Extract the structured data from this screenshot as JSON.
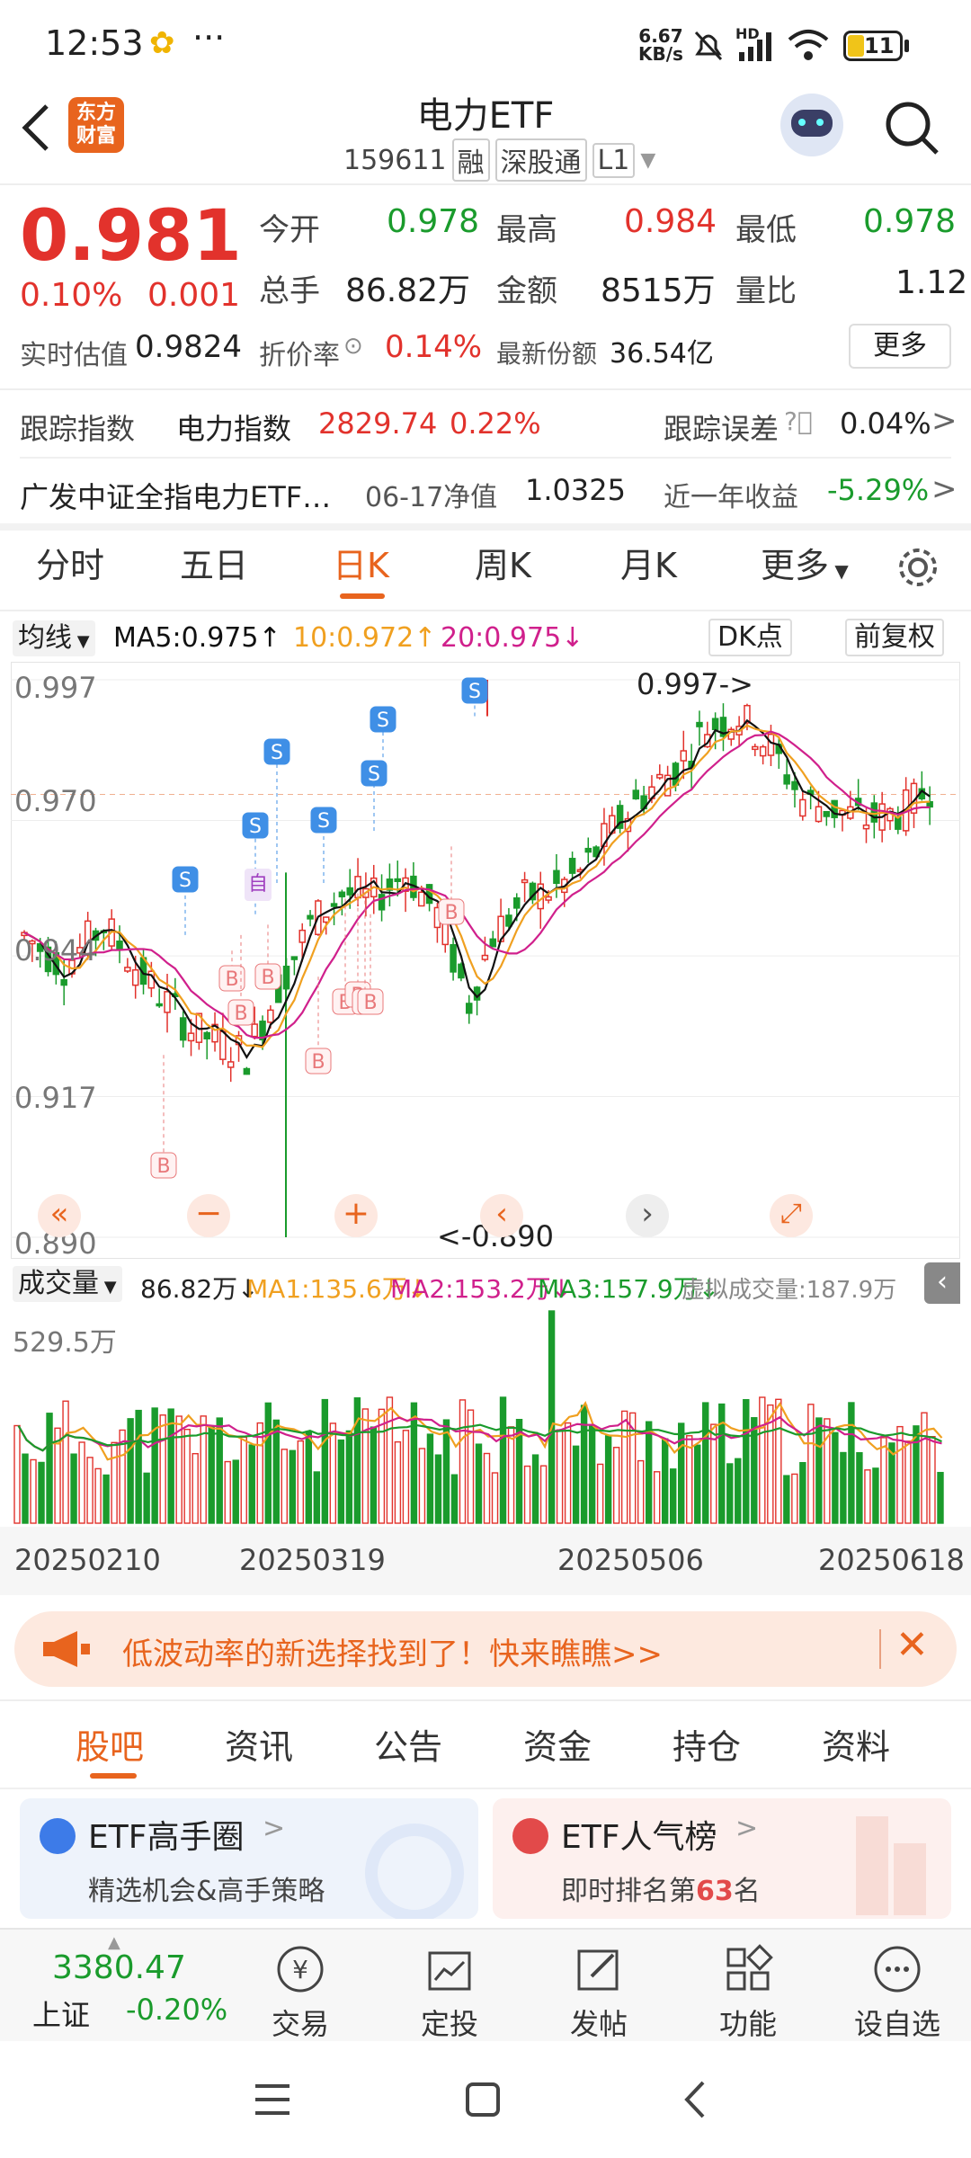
{
  "status_bar": {
    "time": "12:53",
    "dots": "···",
    "net_speed_value": "6.67",
    "net_speed_unit": "KB/s",
    "hd": "HD",
    "battery": "11"
  },
  "header": {
    "logo_line1": "东方",
    "logo_line2": "财富",
    "title": "电力ETF",
    "code": "159611",
    "tag_rong": "融",
    "tag_sgt": "深股通",
    "tag_l1": "L1"
  },
  "quote": {
    "price": "0.981",
    "change_pct": "0.10%",
    "change": "0.001",
    "open_label": "今开",
    "open": "0.978",
    "high_label": "最高",
    "high": "0.984",
    "low_label": "最低",
    "low": "0.978",
    "volume_label": "总手",
    "volume": "86.82万",
    "amount_label": "金额",
    "amount": "8515万",
    "ratio_label": "量比",
    "ratio": "1.12",
    "iopv_label": "实时估值",
    "iopv": "0.9824",
    "discount_label": "折价率",
    "discount": "0.14%",
    "shares_label": "最新份额",
    "shares": "36.54亿",
    "more_button": "更多"
  },
  "tracking": {
    "label": "跟踪指数",
    "index_name": "电力指数",
    "index_value": "2829.74",
    "index_change": "0.22%",
    "error_label": "跟踪误差",
    "error_value": "0.04%",
    "fund_name": "广发中证全指电力ETF…",
    "nav_date_label": "06-17净值",
    "nav_value": "1.0325",
    "year_return_label": "近一年收益",
    "year_return": "-5.29%"
  },
  "chart_tabs": [
    "分时",
    "五日",
    "日K",
    "周K",
    "月K",
    "更多"
  ],
  "active_chart_tab": "日K",
  "ma_bar": {
    "selector": "均线",
    "ma5": "MA5:0.975",
    "ma10": "10:0.972",
    "ma20": "20:0.975",
    "dk_button": "DK点",
    "fq_button": "前复权"
  },
  "price_axis": [
    "0.997",
    "0.970",
    "0.944",
    "0.917",
    "0.890"
  ],
  "chart_annotations": {
    "max_label": "0.997->",
    "min_label": "<-0.890",
    "self_tag": "自"
  },
  "volume_bar": {
    "selector": "成交量",
    "vol": "86.82万",
    "ma1": "MA1:135.6万",
    "ma2": "MA2:153.2万",
    "ma3": "MA3:157.9万",
    "virtual": "虚拟成交量:187.9万",
    "axis_max": "529.5万"
  },
  "date_axis": [
    "20250210",
    "20250319",
    "20250506",
    "20250618"
  ],
  "banner": {
    "text": "低波动率的新选择找到了！快来瞧瞧>>"
  },
  "bottom_tabs": [
    "股吧",
    "资讯",
    "公告",
    "资金",
    "持仓",
    "资料"
  ],
  "active_bottom_tab": "股吧",
  "cards": [
    {
      "title": "ETF高手圈",
      "subtitle": "精选机会&高手策略"
    },
    {
      "title": "ETF人气榜",
      "subtitle_pre": "即时排名第",
      "rank": "63",
      "subtitle_post": "名"
    }
  ],
  "bottom_nav": {
    "index_value": "3380.47",
    "index_name": "上证",
    "index_change": "-0.20%",
    "items": [
      "交易",
      "定投",
      "发帖",
      "功能",
      "设自选"
    ]
  },
  "colors": {
    "up": "#e2322c",
    "down": "#1a9b2c",
    "ma5": "#111111",
    "ma10": "#f0a020",
    "ma20": "#d0208c",
    "accent": "#e8641e"
  },
  "chart_data": {
    "type": "candlestick",
    "ylim": [
      0.89,
      0.997
    ],
    "max_marker": 0.997,
    "min_marker": 0.89,
    "x_ticks": [
      "20250210",
      "20250319",
      "20250506",
      "20250618"
    ],
    "volume_axis_max": "529.5万"
  }
}
